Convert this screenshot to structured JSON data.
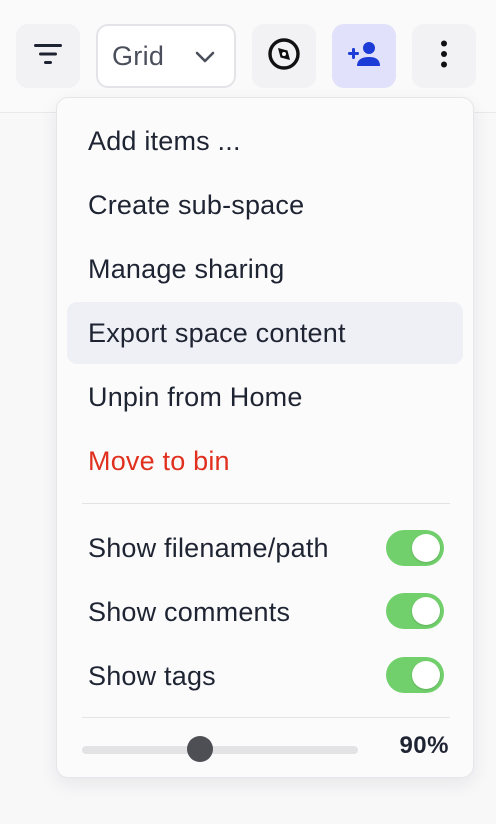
{
  "toolbar": {
    "view_select": {
      "value": "Grid"
    },
    "icons": {
      "filter": "filter-icon",
      "view_chevron": "chevron-down-icon",
      "compass": "compass-icon",
      "share": "add-person-icon",
      "more": "more-vertical-icon"
    },
    "share_active_bg": "#e2e1fb",
    "share_icon_color": "#1d3bd6"
  },
  "menu": {
    "items": [
      {
        "label": "Add items ...",
        "highlighted": false,
        "danger": false
      },
      {
        "label": "Create sub-space",
        "highlighted": false,
        "danger": false
      },
      {
        "label": "Manage sharing",
        "highlighted": false,
        "danger": false
      },
      {
        "label": "Export space content",
        "highlighted": true,
        "danger": false
      },
      {
        "label": "Unpin from Home",
        "highlighted": false,
        "danger": false
      },
      {
        "label": "Move to bin",
        "highlighted": false,
        "danger": true
      }
    ],
    "toggles": [
      {
        "label": "Show filename/path",
        "on": true
      },
      {
        "label": "Show comments",
        "on": true
      },
      {
        "label": "Show tags",
        "on": true
      }
    ],
    "zoom": {
      "value_percent": 90,
      "display": "90%"
    },
    "colors": {
      "danger": "#e0301e",
      "toggle_on": "#72d06c",
      "toggle_off": "#d4d4d8",
      "highlight": "#eef0f6"
    }
  }
}
